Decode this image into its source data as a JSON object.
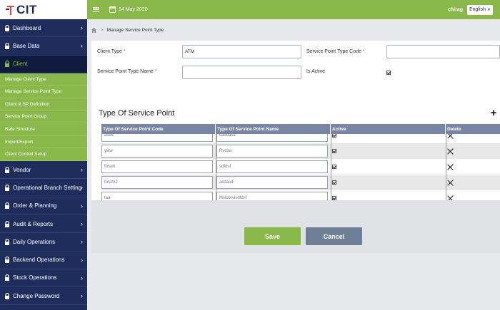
{
  "app": {
    "logo_text": "CIT"
  },
  "topbar": {
    "date": "14 May 2020",
    "user": "chirag",
    "language": "English"
  },
  "sidebar": {
    "items_top": [
      {
        "label": "Dashboard"
      },
      {
        "label": "Base Data"
      },
      {
        "label": "Client"
      }
    ],
    "sub_items": [
      "Manage Client Type",
      "Manage Service Point Type",
      "Client & SP Definition",
      "Service Point Group",
      "Rate Structure",
      "Import/Export",
      "Client Control Setup"
    ],
    "items_bottom": [
      {
        "label": "Vendor"
      },
      {
        "label": "Operational Branch Setting"
      },
      {
        "label": "Order & Planning"
      },
      {
        "label": "Audit & Reports"
      },
      {
        "label": "Daily Operations"
      },
      {
        "label": "Backend Operations"
      },
      {
        "label": "Stock Operations"
      },
      {
        "label": "Change Password"
      }
    ]
  },
  "breadcrumb": {
    "sep": ">",
    "page": "Manage Service Point Type"
  },
  "form": {
    "client_type_label": "Client Type",
    "client_type_value": "ATM",
    "sp_type_code_label": "Service Point Type Code",
    "sp_type_code_value": "",
    "sp_type_name_label": "Service Point Type Name",
    "sp_type_name_value": "",
    "is_active_label": "Is Active",
    "is_active_checked": true,
    "required_mark": "*"
  },
  "section": {
    "title": "Type Of Service Point",
    "add_label": "+",
    "columns": [
      "Type Of Service Point Code",
      "Type Of Service Point Name",
      "Active",
      "Delete"
    ],
    "rows": [
      {
        "code": "asds",
        "name": "saddasa",
        "active": true
      },
      {
        "code": "yww",
        "name": "Rvdsa",
        "active": true
      },
      {
        "code": "foram",
        "name": "sdfdsf",
        "active": true
      },
      {
        "code": "foram2",
        "name": "asdasd",
        "active": true
      },
      {
        "code": "taa",
        "name": "Msldosasdfdsf",
        "active": true
      }
    ]
  },
  "buttons": {
    "save": "Save",
    "cancel": "Cancel"
  },
  "colors": {
    "sidebar": "#1e2d5c",
    "accent": "#8ab84a",
    "header_grid": "#7986a3",
    "cancel": "#6f7f96"
  }
}
